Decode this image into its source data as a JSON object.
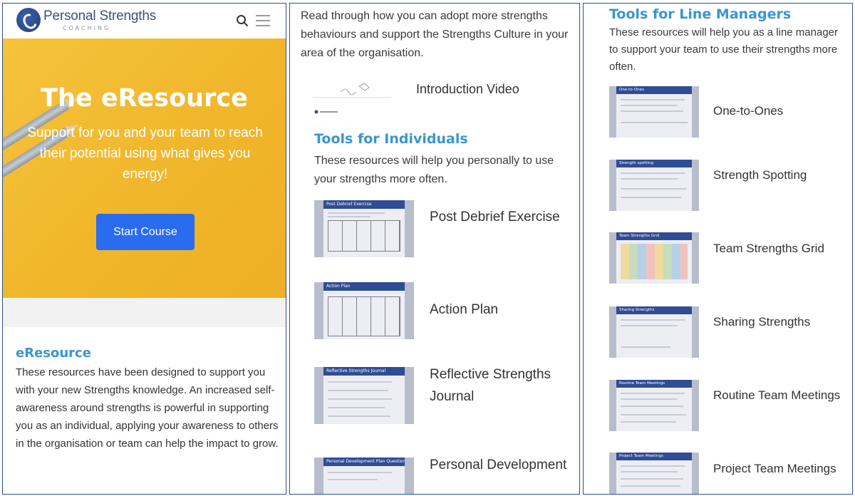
{
  "panel1": {
    "logo": {
      "title": "Personal Strengths",
      "subtitle": "COACHING"
    },
    "hero": {
      "title": "The eResource",
      "subtitle": "Support for you and your team to reach their potential using what gives you energy!",
      "button": "Start Course"
    },
    "eresource": {
      "title": "eResource",
      "body": "These resources have been designed to support you with your new Strengths knowledge. An increased self-awareness around strengths is powerful in supporting you as an individual, applying your awareness to others in the organisation or team can help the impact to grow."
    }
  },
  "panel2": {
    "intro": "Read through how you can adopt more strengths behaviours and support the Strengths Culture in your area of the organisation.",
    "video_label": "Introduction Video",
    "individuals": {
      "title": "Tools for Individuals",
      "body": "These resources will help you personally to use your strengths more often.",
      "items": [
        {
          "label": "Post Debrief Exercise",
          "thumb_title": "Post Debrief Exercise"
        },
        {
          "label": "Action Plan",
          "thumb_title": "Action Plan"
        },
        {
          "label": "Reflective Strengths Journal",
          "thumb_title": "Reflective Strengths Journal"
        },
        {
          "label": "Personal Development",
          "thumb_title": "Personal Development Plan Questions"
        }
      ]
    }
  },
  "panel3": {
    "title": "Tools for Line Managers",
    "body": "These resources will help you as a line manager to support your team to use their strengths more often.",
    "items": [
      {
        "label": "One-to-Ones",
        "thumb_title": "One-to-Ones"
      },
      {
        "label": "Strength Spotting",
        "thumb_title": "Strength spotting"
      },
      {
        "label": "Team Strengths Grid",
        "thumb_title": "Team Strengths Grid"
      },
      {
        "label": "Sharing Strengths",
        "thumb_title": "Sharing Strengths"
      },
      {
        "label": "Routine Team Meetings",
        "thumb_title": "Routine Team Meetings"
      },
      {
        "label": "Project Team Meetings",
        "thumb_title": "Project Team Meetings"
      }
    ]
  },
  "colors": {
    "brand_blue": "#2f4c94",
    "accent_blue": "#3a96d0",
    "button_blue": "#2a6cf0",
    "hero_yellow": "#f0b52a"
  },
  "icons": [
    "logo-mark-icon",
    "search-icon",
    "menu-icon",
    "pencil-icon"
  ]
}
